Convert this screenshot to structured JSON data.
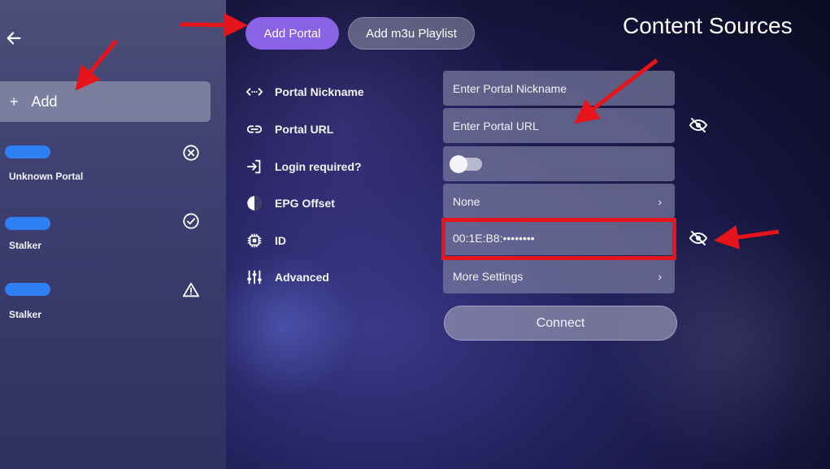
{
  "sidebar": {
    "add_label": "Add",
    "add_symbol": "+",
    "portals": [
      {
        "name": "Unknown Portal",
        "status_icon": "x-circle-icon"
      },
      {
        "name": "Stalker",
        "status_icon": "check-circle-icon"
      },
      {
        "name": "Stalker",
        "status_icon": "warning-triangle-icon"
      }
    ]
  },
  "tabs": [
    {
      "label": "Add Portal",
      "active": true
    },
    {
      "label": "Add m3u Playlist",
      "active": false
    }
  ],
  "page_title": "Content Sources",
  "form": {
    "fields": [
      {
        "label": "Portal Nickname",
        "icon": "code-arrows-icon",
        "value": "Enter Portal Nickname"
      },
      {
        "label": "Portal URL",
        "icon": "link-icon",
        "value": "Enter Portal URL"
      },
      {
        "label": "Login required?",
        "icon": "login-icon",
        "toggle_on": false
      },
      {
        "label": "EPG Offset",
        "icon": "clock-icon",
        "value": "None"
      },
      {
        "label": "ID",
        "icon": "chip-icon",
        "value": "00:1E:B8:••••••••"
      },
      {
        "label": "Advanced",
        "icon": "sliders-icon",
        "value": "More Settings"
      }
    ],
    "chevron": "›",
    "connect_label": "Connect"
  },
  "colors": {
    "accent": "#8a62e6",
    "annotation": "#e8141b",
    "redaction": "#2f7ff5"
  }
}
